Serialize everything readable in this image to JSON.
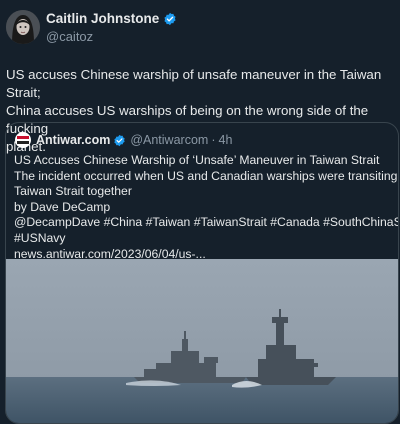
{
  "author": {
    "name": "Caitlin Johnstone",
    "handle": "@caitoz",
    "verified": true,
    "avatar_icon": "avatar-portrait-icon"
  },
  "tweet": {
    "line1": "US accuses Chinese warship of unsafe maneuver in the Taiwan Strait;",
    "line2": "China accuses US warships of being on the wrong side of the fucking",
    "line3": "planet."
  },
  "quote": {
    "name": "Antiwar.com",
    "handle": "@Antiwarcom",
    "separator": "·",
    "time": "4h",
    "verified": true,
    "lines": [
      "US Accuses Chinese Warship of ‘Unsafe’ Maneuver in Taiwan Strait",
      "The incident occurred when US and Canadian warships were transiting the",
      "Taiwan Strait together",
      "by Dave DeCamp",
      "@DecampDave #China #Taiwan #TaiwanStrait #Canada #SouthChinaSea",
      "#USNavy",
      "news.antiwar.com/2023/06/04/us-..."
    ],
    "image_icon": "warships-photo-icon"
  },
  "colors": {
    "background": "#15202b",
    "text": "#e7e9ea",
    "muted": "#8b98a5",
    "verified": "#1d9bf0",
    "border": "#38444d"
  }
}
